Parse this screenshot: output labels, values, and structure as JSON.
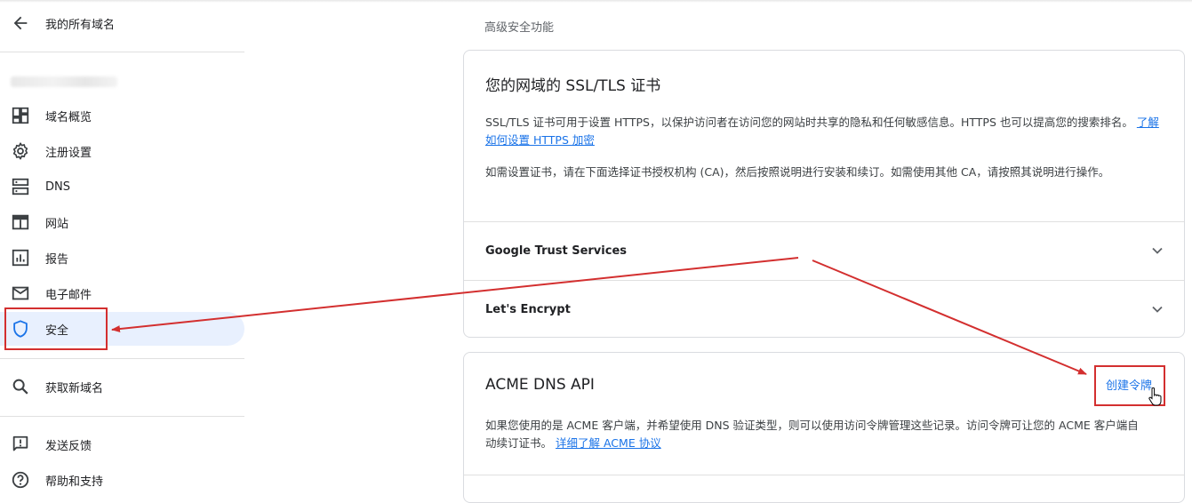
{
  "sidebar": {
    "back_label": "我的所有域名",
    "items": [
      {
        "label": "域名概览",
        "icon": "dashboard-icon"
      },
      {
        "label": "注册设置",
        "icon": "gear-icon"
      },
      {
        "label": "DNS",
        "icon": "dns-icon"
      },
      {
        "label": "网站",
        "icon": "website-icon"
      },
      {
        "label": "报告",
        "icon": "report-icon"
      },
      {
        "label": "电子邮件",
        "icon": "mail-icon"
      },
      {
        "label": "安全",
        "icon": "shield-icon",
        "active": true
      }
    ],
    "get_domain": "获取新域名",
    "feedback": "发送反馈",
    "help": "帮助和支持"
  },
  "main": {
    "section_label": "高级安全功能",
    "ssl_card": {
      "title": "您的网域的 SSL/TLS 证书",
      "para1": "SSL/TLS 证书可用于设置 HTTPS，以保护访问者在访问您的网站时共享的隐私和任何敏感信息。HTTPS 也可以提高您的搜索排名。",
      "para1_link": "了解如何设置 HTTPS 加密",
      "para2": "如需设置证书，请在下面选择证书授权机构 (CA)，然后按照说明进行安装和续订。如需使用其他 CA，请按照其说明进行操作。",
      "providers": [
        "Google Trust Services",
        "Let's Encrypt"
      ]
    },
    "acme_card": {
      "title": "ACME DNS API",
      "create_token": "创建令牌",
      "text": "如果您使用的是 ACME 客户端，并希望使用 DNS 验证类型，则可以使用访问令牌管理这些记录。访问令牌可让您的 ACME 客户端自动续订证书。",
      "link": "详细了解 ACME 协议"
    }
  },
  "colors": {
    "accent": "#1a73e8",
    "active_bg": "#e8f0fe",
    "annotation": "#d32f2f"
  }
}
